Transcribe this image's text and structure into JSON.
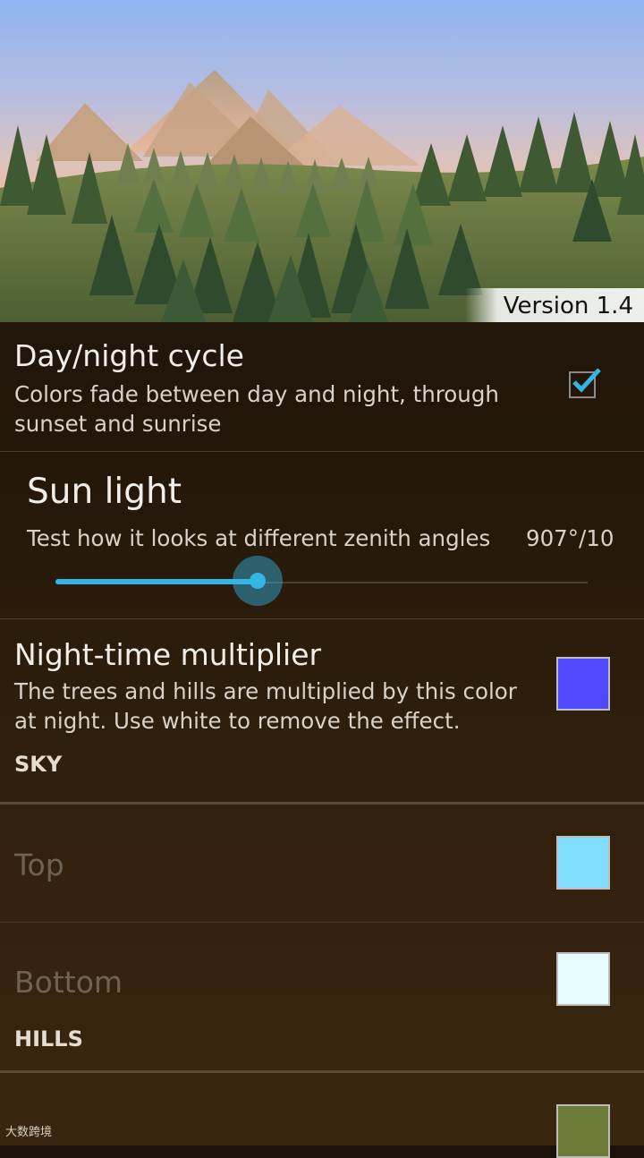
{
  "header": {
    "version_label": "Version 1.4",
    "sky_colors": {
      "top": "#8fb4f2",
      "middle": "#c8bfd4",
      "bottom": "#f0b99c"
    }
  },
  "settings": {
    "day_night": {
      "title": "Day/night cycle",
      "summary_line1": "Colors fade between day and night, through",
      "summary_line2": "sunset and sunrise",
      "checked": true
    },
    "sun_light": {
      "title": "Sun light",
      "summary": "Test how it looks at different zenith angles",
      "value_label": "907°/10",
      "slider_fraction": 0.38
    },
    "night_multiplier": {
      "title": "Night-time multiplier",
      "summary_line1": "The trees and hills are multiplied by this color",
      "summary_line2": "at night. Use white to remove the effect.",
      "color": "#5148ff"
    },
    "sky_category": "SKY",
    "sky_top": {
      "title": "Top",
      "color": "#80dfff"
    },
    "sky_bottom": {
      "title": "Bottom",
      "color": "#e6fbfd"
    },
    "hills_category": "HILLS",
    "hills_first": {
      "color": "#6c7a38"
    }
  },
  "watermark": "大数跨境",
  "accent_color": "#33b5e5"
}
